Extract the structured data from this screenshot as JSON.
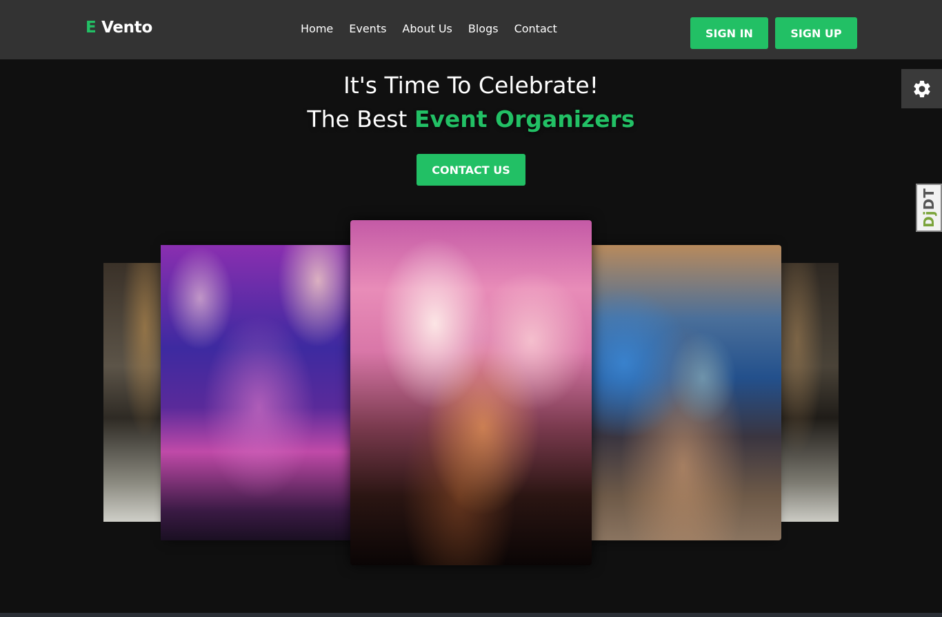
{
  "brand": {
    "letter": "E",
    "name": "Vento"
  },
  "nav": {
    "links": [
      "Home",
      "Events",
      "About Us",
      "Blogs",
      "Contact"
    ],
    "sign_in": "SIGN IN",
    "sign_up": "SIGN UP"
  },
  "hero": {
    "line1": "It's Time To Celebrate!",
    "line2_prefix": "The Best ",
    "line2_highlight": "Event Organizers",
    "cta": "CONTACT US"
  },
  "sidebar": {
    "settings_icon": "gear-icon",
    "debug_toolbar": {
      "prefix": "Dj",
      "suffix": "DT"
    }
  },
  "carousel": {
    "slides": [
      "banquet-hall",
      "purple-ballroom",
      "concert-crowd",
      "conference-audience",
      "banquet-hall"
    ]
  },
  "colors": {
    "accent": "#22c065",
    "navbar": "#333333",
    "background": "#101010"
  }
}
